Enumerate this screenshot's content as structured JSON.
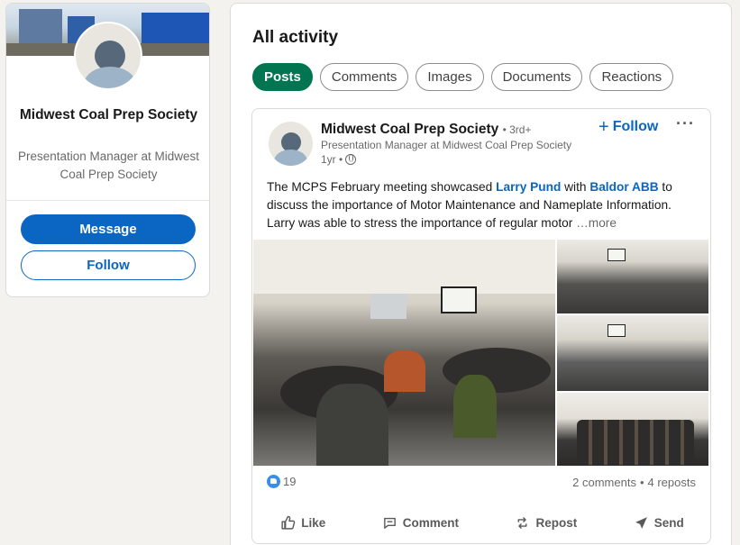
{
  "profile": {
    "name": "Midwest Coal Prep Society",
    "headline": "Presentation Manager at Midwest Coal Prep Society",
    "message_label": "Message",
    "follow_label": "Follow"
  },
  "activity": {
    "title": "All activity",
    "filters": [
      {
        "label": "Posts",
        "active": true
      },
      {
        "label": "Comments",
        "active": false
      },
      {
        "label": "Images",
        "active": false
      },
      {
        "label": "Documents",
        "active": false
      },
      {
        "label": "Reactions",
        "active": false
      }
    ]
  },
  "post": {
    "author": "Midwest Coal Prep Society",
    "degree": "• 3rd+",
    "author_headline": "Presentation Manager at Midwest Coal Prep Society",
    "time": "1yr •",
    "follow_label": "Follow",
    "text_1": "The MCPS February meeting showcased ",
    "mention_1": "Larry Pund",
    "text_2": " with ",
    "mention_2": "Baldor ABB",
    "text_3": " to discuss the importance of Motor Maintenance and Nameplate Information. Larry was able to stress the importance of regular motor ",
    "see_more": "…more",
    "reaction_count": "19",
    "comments": "2 comments",
    "separator": "•",
    "reposts": "4 reposts",
    "actions": {
      "like": "Like",
      "comment": "Comment",
      "repost": "Repost",
      "send": "Send"
    }
  },
  "icons": [
    "like-icon",
    "comment-icon",
    "repost-icon",
    "send-icon",
    "globe-icon",
    "plus-icon",
    "more-icon"
  ],
  "colors": {
    "accent": "#0a66c2",
    "active_filter": "#01754f",
    "background": "#f4f2ee"
  }
}
